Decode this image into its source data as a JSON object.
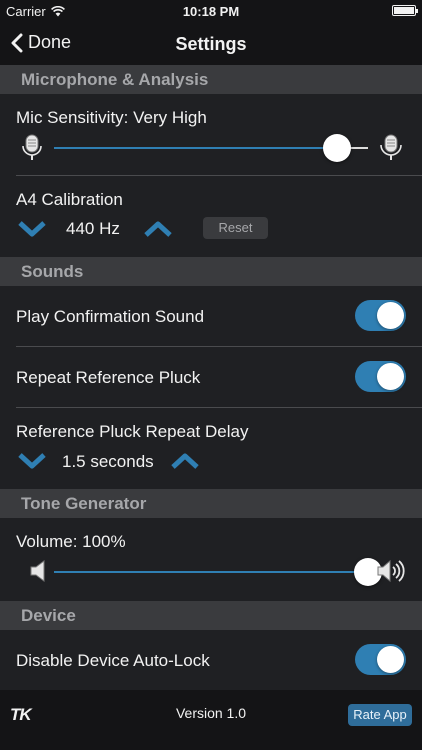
{
  "status_bar": {
    "carrier": "Carrier",
    "time": "10:18 PM"
  },
  "nav": {
    "back_label": "Done",
    "title": "Settings"
  },
  "sections": {
    "microphone": {
      "header": "Microphone & Analysis",
      "mic_sensitivity_label": "Mic Sensitivity: Very High",
      "mic_sensitivity_level": 0.9,
      "a4_label": "A4 Calibration",
      "a4_value": "440 Hz",
      "reset_label": "Reset"
    },
    "sounds": {
      "header": "Sounds",
      "play_confirmation_label": "Play Confirmation Sound",
      "play_confirmation_on": true,
      "repeat_pluck_label": "Repeat Reference Pluck",
      "repeat_pluck_on": true,
      "repeat_delay_label": "Reference Pluck Repeat Delay",
      "repeat_delay_value": "1.5 seconds"
    },
    "tone_generator": {
      "header": "Tone Generator",
      "volume_label": "Volume: 100%",
      "volume_level": 1.0
    },
    "device": {
      "header": "Device",
      "auto_lock_label": "Disable Device Auto-Lock",
      "auto_lock_on": true
    }
  },
  "footer": {
    "logo": "TK",
    "version": "Version 1.0",
    "rate_label": "Rate App"
  },
  "colors": {
    "accent": "#2f7fb3",
    "background": "#1f2023",
    "section_header": "#3a3b3e",
    "bars": "#141416"
  }
}
